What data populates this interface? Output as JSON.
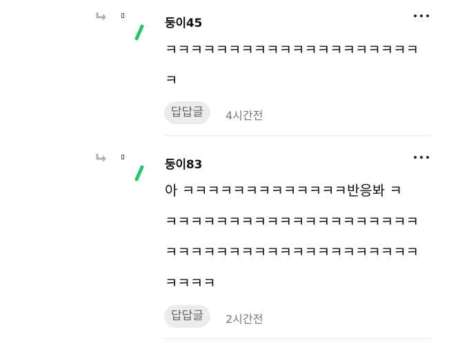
{
  "comments": [
    {
      "author": "둥이45",
      "lines": [
        "ㅋㅋㅋㅋㅋㅋㅋㅋㅋㅋㅋㅋㅋㅋㅋㅋㅋㅋㅋㅋ",
        "ㅋ"
      ],
      "reply_label": "답답글",
      "time": "4시간전"
    },
    {
      "author": "둥이83",
      "lines": [
        "아 ㅋㅋㅋㅋㅋㅋㅋㅋㅋㅋㅋㅋㅋ반응봐 ㅋ",
        "ㅋㅋㅋㅋㅋㅋㅋㅋㅋㅋㅋㅋㅋㅋㅋㅋㅋㅋㅋㅋ",
        "ㅋㅋㅋㅋㅋㅋㅋㅋㅋㅋㅋㅋㅋㅋㅋㅋㅋㅋㅋㅋ",
        "ㅋㅋㅋㅋ"
      ],
      "reply_label": "답답글",
      "time": "2시간전"
    }
  ],
  "icons": {
    "reply": "reply-arrow-icon",
    "badge": "green-badge-icon",
    "more": "more-options-icon"
  },
  "colors": {
    "badge_green": "#27c46b",
    "reply_button_bg": "#ececec"
  }
}
